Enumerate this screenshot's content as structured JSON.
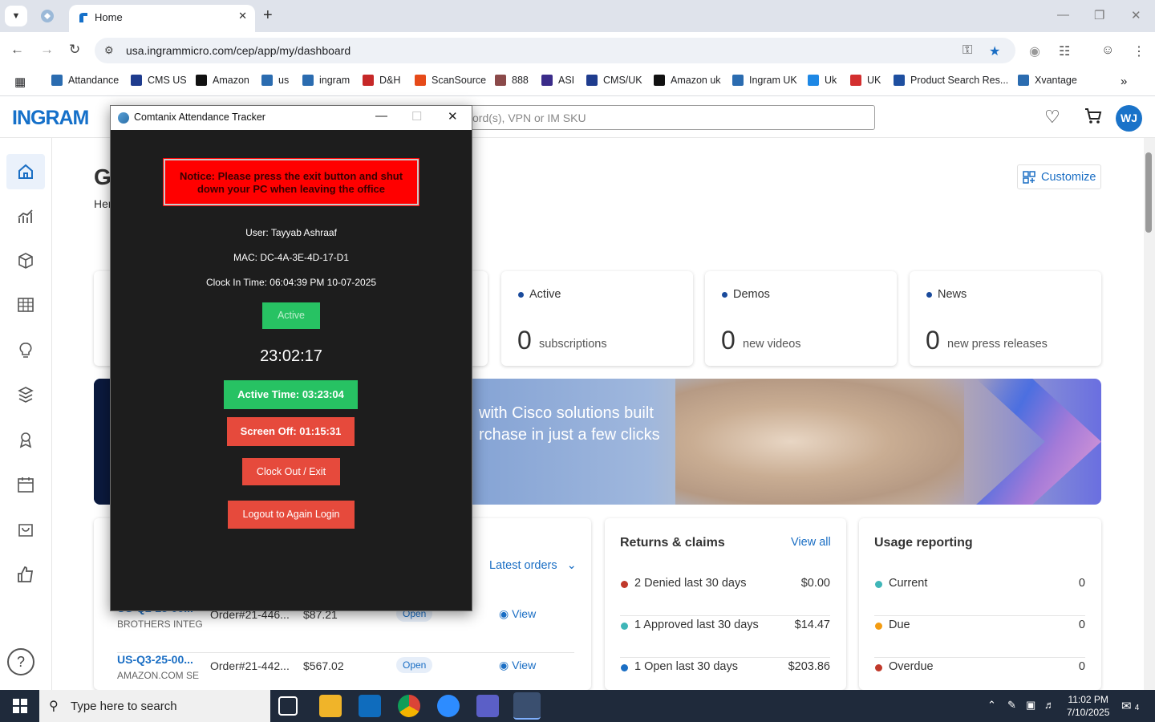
{
  "browser": {
    "tab_title": "Home",
    "url": "usa.ingrammicro.com/cep/app/my/dashboard",
    "bookmarks": [
      "Attandance",
      "CMS US",
      "Amazon",
      "us",
      "ingram",
      "D&H",
      "ScanSource",
      "888",
      "ASI",
      "CMS/UK",
      "Amazon uk",
      "Ingram UK",
      "Uk",
      "UK",
      "Product Search Res...",
      "Xvantage"
    ],
    "bookmark_colors": [
      "#2b6cb0",
      "#1f3c8e",
      "#111111",
      "#2b6cb0",
      "#2b6cb0",
      "#c62828",
      "#e64a19",
      "#8b4a4a",
      "#3b2c8a",
      "#1f3c8e",
      "#111111",
      "#2b6cb0",
      "#1e88e5",
      "#d32f2f",
      "#1e4fa0",
      "#2b6cb0"
    ]
  },
  "site": {
    "logo": "INGRAM",
    "search_placeholder": "ord(s), VPN or IM SKU",
    "avatar_initials": "WJ",
    "page_title": "G",
    "page_subtitle": "Her",
    "customize_label": "Customize"
  },
  "stats": [
    {
      "label": "Active",
      "value": "0",
      "unit": "subscriptions"
    },
    {
      "label": "Demos",
      "value": "0",
      "unit": "new videos"
    },
    {
      "label": "News",
      "value": "0",
      "unit": "new press releases"
    }
  ],
  "banner": {
    "line1": "with Cisco solutions built",
    "line2": "rchase in just a few clicks"
  },
  "orders": {
    "dropdown_label": "Latest orders",
    "rows": [
      {
        "id": "US-Q2-25-00...",
        "customer": "BROTHERS INTEG",
        "order": "Order#21-446...",
        "amount": "$87.21",
        "status": "Open",
        "action": "View"
      },
      {
        "id": "US-Q3-25-00...",
        "customer": "AMAZON.COM SE",
        "order": "Order#21-442...",
        "amount": "$567.02",
        "status": "Open",
        "action": "View"
      }
    ]
  },
  "returns": {
    "title": "Returns & claims",
    "view_all": "View all",
    "rows": [
      {
        "label": "2 Denied last 30 days",
        "value": "$0.00",
        "color": "#c0392b"
      },
      {
        "label": "1 Approved last 30 days",
        "value": "$14.47",
        "color": "#3fb6b8"
      },
      {
        "label": "1 Open last 30 days",
        "value": "$203.86",
        "color": "#1a6ec4"
      }
    ]
  },
  "usage": {
    "title": "Usage reporting",
    "rows": [
      {
        "label": "Current",
        "value": "0",
        "color": "#3fb6b8"
      },
      {
        "label": "Due",
        "value": "0",
        "color": "#f39c12"
      },
      {
        "label": "Overdue",
        "value": "0",
        "color": "#c0392b"
      }
    ]
  },
  "tracker": {
    "window_title": "Comtanix Attendance Tracker",
    "notice": "Notice: Please press the exit button and shut down your PC when leaving the office",
    "user": "User: Tayyab Ashraaf",
    "mac": "MAC: DC-4A-3E-4D-17-D1",
    "clock_in": "Clock In Time: 06:04:39 PM 10-07-2025",
    "status": "Active",
    "clock": "23:02:17",
    "active_time": "Active Time: 03:23:04",
    "screen_off": "Screen Off: 01:15:31",
    "clock_out": "Clock Out / Exit",
    "logout": "Logout to Again Login",
    "colors": {
      "status_green": "#27c263",
      "active_green": "#27c263",
      "screen_red": "#e64a3c",
      "notice_red": "#ff0000"
    }
  },
  "taskbar": {
    "search_placeholder": "Type here to search",
    "time": "11:02 PM",
    "date": "7/10/2025",
    "notifications": "4"
  }
}
